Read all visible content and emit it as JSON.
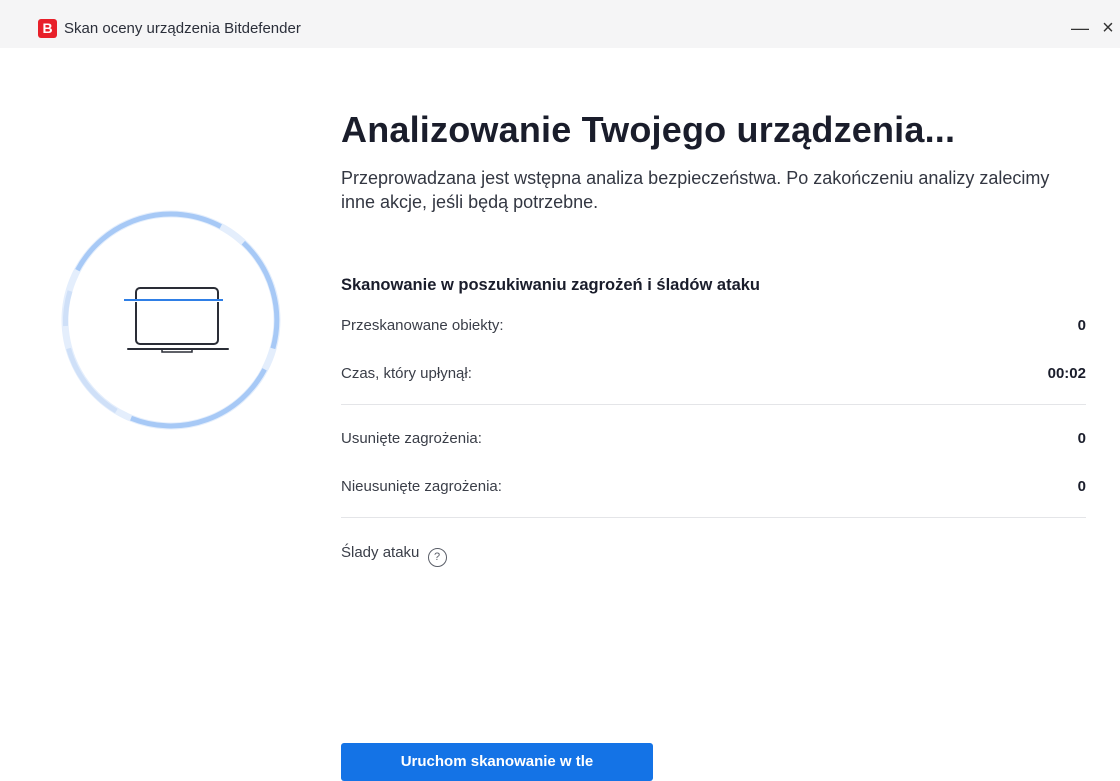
{
  "window": {
    "logo_letter": "B",
    "title": "Skan oceny urządzenia Bitdefender",
    "minimize_glyph": "—",
    "close_glyph": "×"
  },
  "main": {
    "headline": "Analizowanie Twojego urządzenia...",
    "description": "Przeprowadzana jest wstępna analiza bezpieczeństwa. Po zakończeniu analizy zalecimy inne akcje, jeśli będą potrzebne.",
    "section_title": "Skanowanie w poszukiwaniu zagrożeń i śladów ataku",
    "stats": [
      {
        "label": "Przeskanowane obiekty:",
        "value": "0"
      },
      {
        "label": "Czas, który upłynął:",
        "value": "00:02"
      },
      {
        "label": "Usunięte zagrożenia:",
        "value": "0"
      },
      {
        "label": "Nieusunięte zagrożenia:",
        "value": "0"
      }
    ],
    "attack_traces_label": "Ślady ataku",
    "help_glyph": "?",
    "background_scan_button": "Uruchom skanowanie w tle"
  },
  "icons": {
    "scan": "laptop-scan-icon",
    "help": "question-circle-icon"
  },
  "colors": {
    "brand_red": "#e8202a",
    "primary_blue": "#1473e6",
    "ring_blue": "#9ec4f5",
    "ring_light": "#e4eefc",
    "scan_line": "#2f7fe6"
  }
}
